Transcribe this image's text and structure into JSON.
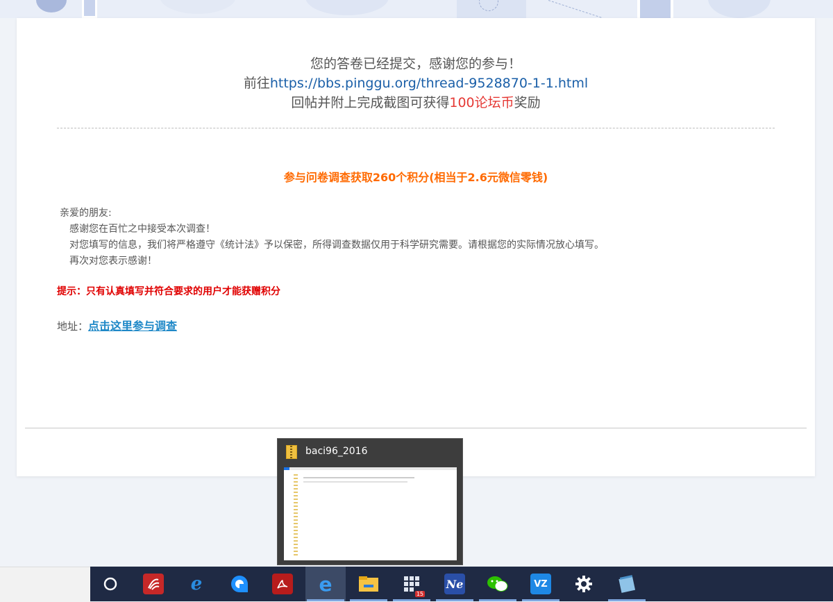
{
  "confirmation": {
    "line1": "您的答卷已经提交，感谢您的参与！",
    "line2_prefix": "前往",
    "line2_link": "https://bbs.pinggu.org/thread-9528870-1-1.html",
    "line3_prefix": "回帖并附上完成截图可获得",
    "line3_highlight": "100论坛币",
    "line3_suffix": "奖励"
  },
  "promo": {
    "title": "参与问卷调查获取260个积分(相当于2.6元微信零钱)",
    "greeting": "亲爱的朋友:",
    "para1": "感谢您在百忙之中接受本次调查！",
    "para2": "对您填写的信息，我们将严格遵守《统计法》予以保密，所得调查数据仅用于科学研究需要。请根据您的实际情况放心填写。",
    "para3": "再次对您表示感谢！",
    "tip": "提示：只有认真填写并符合要求的用户才能获赠积分",
    "address_label": "地址：",
    "address_link": "点击这里参与调查"
  },
  "thumbnail": {
    "title": "baci96_2016",
    "icon": "zip-folder-icon"
  },
  "taskbar": {
    "items": [
      {
        "name": "cortana-icon"
      },
      {
        "name": "chaoxing-icon"
      },
      {
        "name": "internet-explorer-icon"
      },
      {
        "name": "cloud-app-icon"
      },
      {
        "name": "acrobat-icon"
      },
      {
        "name": "edge-icon"
      },
      {
        "name": "file-explorer-icon"
      },
      {
        "name": "tiles-app-icon",
        "badge": "15"
      },
      {
        "name": "notexpress-icon",
        "label": "Ne"
      },
      {
        "name": "wechat-icon"
      },
      {
        "name": "vz-app-icon",
        "label": "VZ"
      },
      {
        "name": "settings-icon"
      },
      {
        "name": "notepad-icon"
      }
    ]
  },
  "colors": {
    "link": "#1a5fa8",
    "highlight_red": "#e53935",
    "promo_orange": "#ff6a00",
    "tip_red": "#e00000",
    "taskbar_bg": "#1f2a44"
  }
}
